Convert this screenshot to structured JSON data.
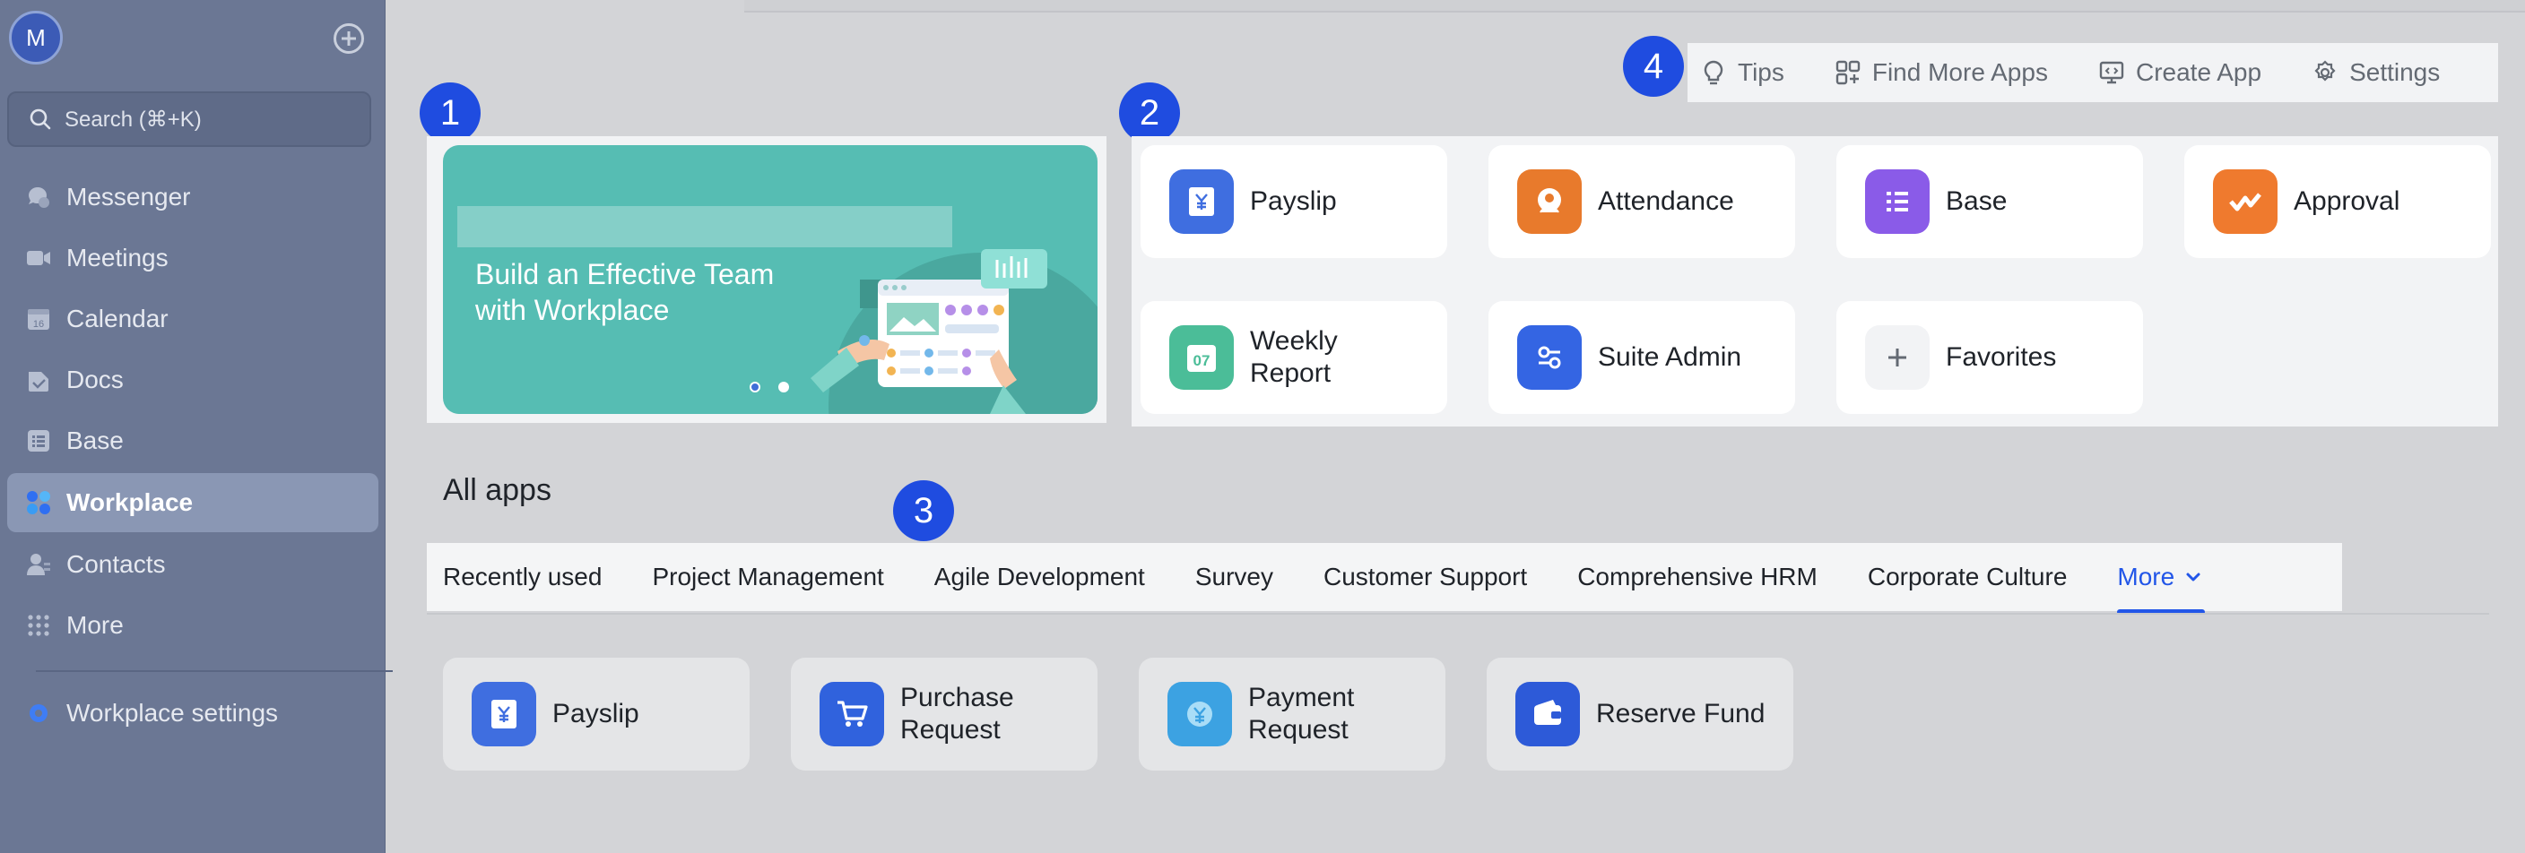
{
  "sidebar": {
    "avatar_initial": "M",
    "search_placeholder": "Search (⌘+K)",
    "items": [
      {
        "label": "Messenger",
        "icon": "messenger-icon"
      },
      {
        "label": "Meetings",
        "icon": "video-icon"
      },
      {
        "label": "Calendar",
        "icon": "calendar-icon"
      },
      {
        "label": "Docs",
        "icon": "docs-icon"
      },
      {
        "label": "Base",
        "icon": "base-icon"
      },
      {
        "label": "Workplace",
        "icon": "workplace-icon",
        "active": true
      },
      {
        "label": "Contacts",
        "icon": "contacts-icon"
      },
      {
        "label": "More",
        "icon": "grid-icon"
      }
    ],
    "settings_label": "Workplace settings",
    "calendar_day": "16"
  },
  "toolbar": {
    "tips": "Tips",
    "find_more_apps": "Find More Apps",
    "create_app": "Create App",
    "settings": "Settings"
  },
  "badges": [
    "1",
    "2",
    "3",
    "4"
  ],
  "banner": {
    "text_line1": "Build an Effective Team",
    "text_line2": "with Workplace"
  },
  "favorite_apps": [
    {
      "name": "Payslip",
      "color": "#3f6ee0"
    },
    {
      "name": "Attendance",
      "color": "#e87a2c"
    },
    {
      "name": "Base",
      "color": "#8a5be8"
    },
    {
      "name": "Approval",
      "color": "#ef7a2e"
    },
    {
      "name": "Weekly Report",
      "color": "#4bbd98",
      "icon_text": "07"
    },
    {
      "name": "Suite Admin",
      "color": "#3465e3"
    },
    {
      "name": "Favorites",
      "color": "#f2f3f5"
    }
  ],
  "all_apps": {
    "title": "All apps",
    "tabs": [
      "Recently used",
      "Project Management",
      "Agile Development",
      "Survey",
      "Customer Support",
      "Comprehensive HRM",
      "Corporate Culture",
      "More"
    ],
    "apps": [
      {
        "name": "Payslip",
        "color": "#3f6ee0"
      },
      {
        "name": "Purchase Request",
        "color": "#3062dd"
      },
      {
        "name": "Payment Request",
        "color": "#3ca2e2"
      },
      {
        "name": "Reserve Fund",
        "color": "#2d5ad8"
      }
    ]
  },
  "colors": {
    "sidebar_bg": "#6b7794",
    "accent": "#2256e8",
    "badge": "#1f4ce0",
    "banner": "#56bdb3"
  }
}
